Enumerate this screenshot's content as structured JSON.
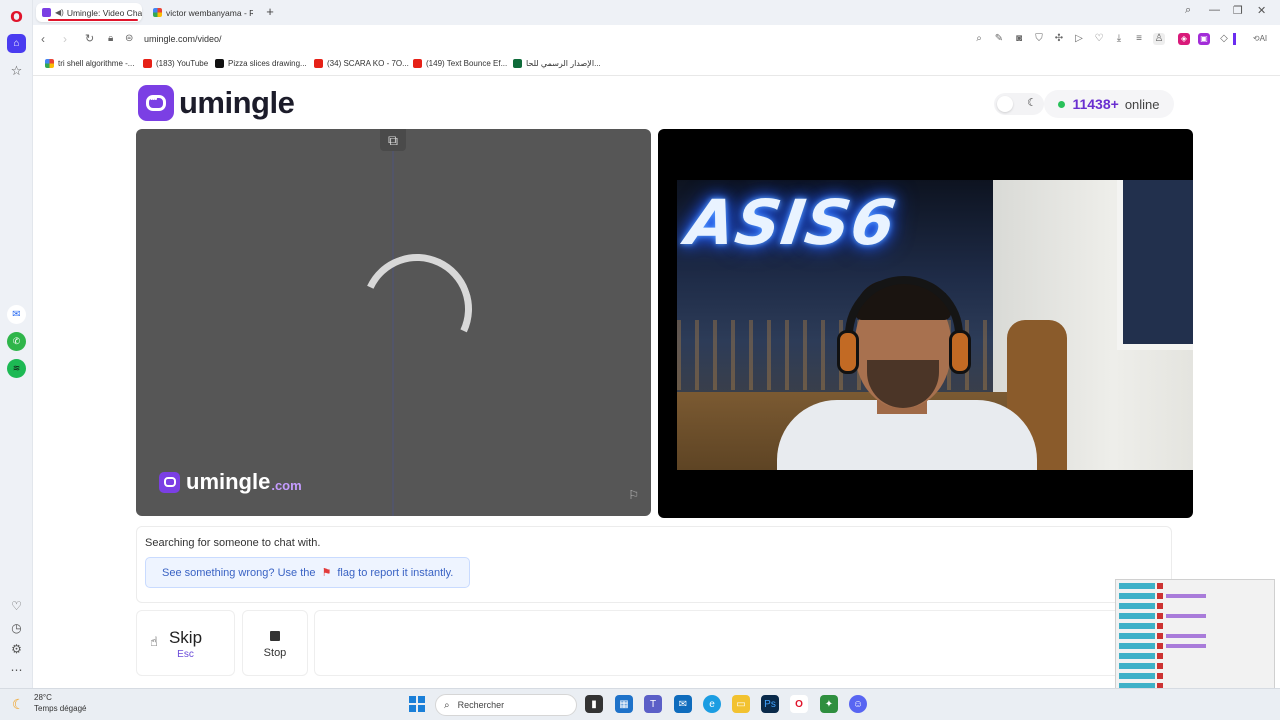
{
  "browser": {
    "tabs": [
      {
        "title": "Umingle: Video Chat -",
        "active": true
      },
      {
        "title": "victor wembanyama - Rec",
        "active": false
      }
    ],
    "url": "umingle.com/video/",
    "bookmarks": [
      "tri shell algorithme -...",
      "(183) YouTube",
      "Pizza slices drawing...",
      "(34) SCARA KO - 7O...",
      "(149) Text Bounce Ef...",
      "الإصدار الرسمي للحا..."
    ]
  },
  "site": {
    "logo_text": "umingle",
    "online_count": "11438+",
    "online_label": "online"
  },
  "stranger": {
    "watermark_text": "umingle",
    "watermark_domain": ".com"
  },
  "self_cam": {
    "neon_sign": "ASIS6"
  },
  "status": {
    "text": "Searching for someone to chat with.",
    "notice_before": "See something wrong? Use the",
    "notice_after": "flag to report it instantly."
  },
  "controls": {
    "skip_label": "Skip",
    "skip_key": "Esc",
    "stop_label": "Stop"
  },
  "taskbar": {
    "temperature": "28°C",
    "weather": "Temps dégagé",
    "search_placeholder": "Rechercher"
  },
  "colors": {
    "brand_purple": "#7b3fe4",
    "online_green": "#29c15a",
    "notice_blue": "#3a63c4",
    "opera_red": "#e0142b"
  }
}
